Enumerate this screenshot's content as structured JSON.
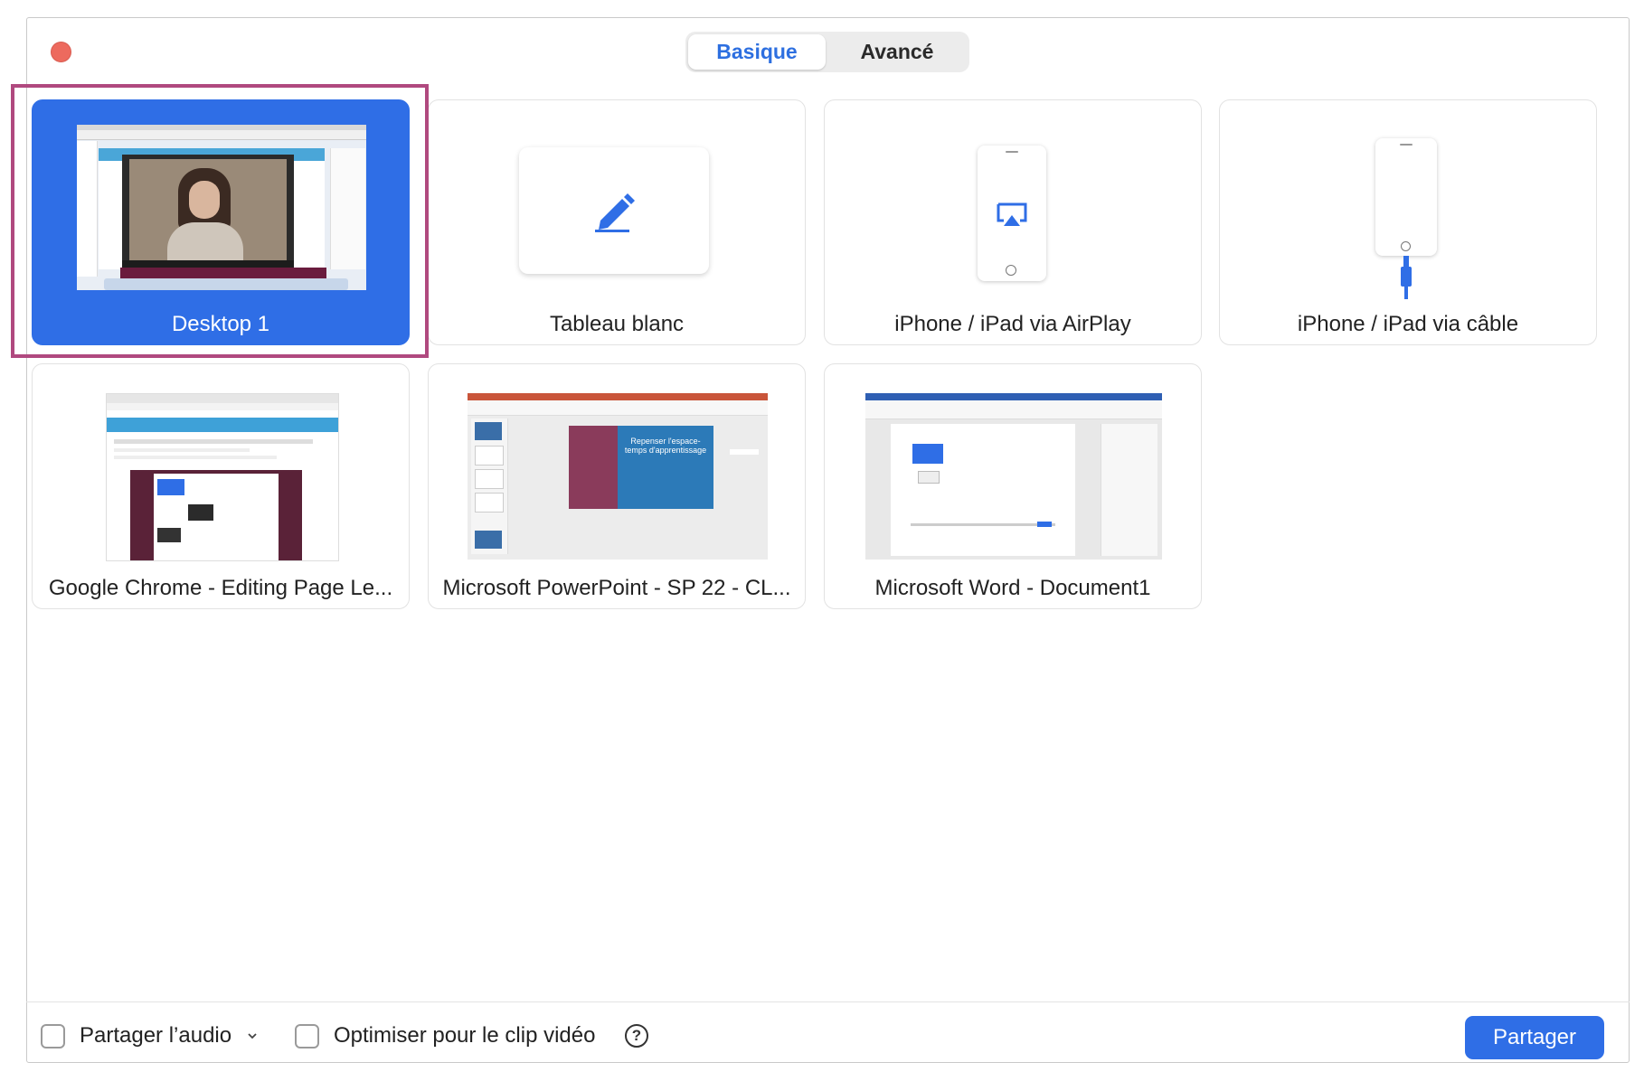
{
  "tabs": [
    {
      "label": "Basique",
      "active": true
    },
    {
      "label": "Avancé",
      "active": false
    }
  ],
  "tiles": [
    {
      "label": "Desktop 1",
      "selected": true,
      "icon": "desktop-thumbnail"
    },
    {
      "label": "Tableau blanc",
      "selected": false,
      "icon": "pencil-icon"
    },
    {
      "label": "iPhone / iPad via AirPlay",
      "selected": false,
      "icon": "airplay-icon"
    },
    {
      "label": "iPhone / iPad via câble",
      "selected": false,
      "icon": "cable-icon"
    },
    {
      "label": "Google Chrome - Editing Page Le...",
      "selected": false,
      "icon": "chrome-thumbnail"
    },
    {
      "label": "Microsoft PowerPoint - SP 22 - CL...",
      "selected": false,
      "icon": "powerpoint-thumbnail"
    },
    {
      "label": "Microsoft Word - Document1",
      "selected": false,
      "icon": "word-thumbnail"
    }
  ],
  "ppt_slide": {
    "title": "Repenser l'espace-temps d'apprentissage"
  },
  "footer": {
    "share_audio_label": "Partager l’audio",
    "optimize_label": "Optimiser pour le clip vidéo",
    "share_button": "Partager"
  },
  "colors": {
    "accent": "#2f6ee6",
    "highlight_border": "#b0497f",
    "close_button": "#ed6a5e"
  }
}
